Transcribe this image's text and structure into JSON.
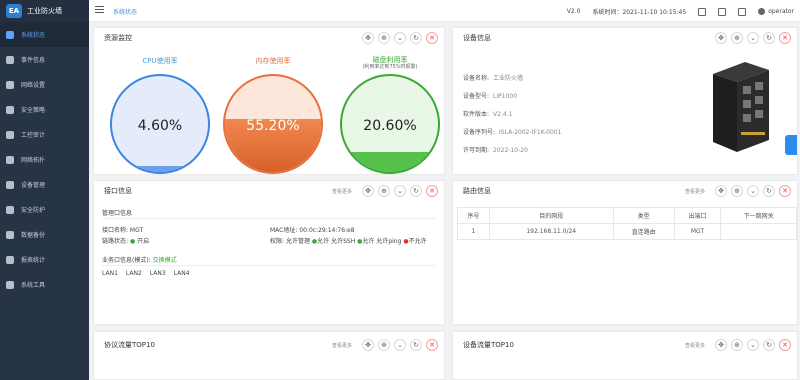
{
  "app": {
    "logo_badge": "EA",
    "title": "工业防火墙"
  },
  "sidebar": {
    "items": [
      {
        "label": "系统状态",
        "icon": "dashboard-icon"
      },
      {
        "label": "事件信息",
        "icon": "event-icon"
      },
      {
        "label": "网络设置",
        "icon": "network-icon"
      },
      {
        "label": "安全策略",
        "icon": "policy-icon"
      },
      {
        "label": "工控审计",
        "icon": "audit-icon"
      },
      {
        "label": "网络拓扑",
        "icon": "topology-icon"
      },
      {
        "label": "设备管理",
        "icon": "device-icon"
      },
      {
        "label": "安全防护",
        "icon": "shield-icon"
      },
      {
        "label": "数据备份",
        "icon": "backup-icon"
      },
      {
        "label": "报表统计",
        "icon": "report-icon"
      },
      {
        "label": "系统工具",
        "icon": "tools-icon"
      }
    ]
  },
  "header": {
    "breadcrumb": "系统状态",
    "version": "V2.0",
    "time_label": "系统时间：2021-11-10 10:15:45",
    "user": "operator"
  },
  "panels": {
    "resource": {
      "title": "资源监控",
      "cpu": {
        "label": "CPU使用率",
        "value": "4.60%",
        "fraction": 0.046
      },
      "mem": {
        "label": "内存使用率",
        "value": "55.20%",
        "fraction": 0.552
      },
      "disk": {
        "label": "磁盘利用率",
        "sub": "(利用率达到75%时报警)",
        "value": "20.60%",
        "fraction": 0.206
      }
    },
    "device": {
      "title": "设备信息",
      "name_label": "设备名称:",
      "name": "工业防火墙",
      "model_label": "设备型号:",
      "model": "LIP1000",
      "sw_label": "软件版本:",
      "sw": "V2.4.1",
      "serial_label": "设备序列号:",
      "serial": "ISLA-2002-IF1K-0001",
      "license_label": "许可到期:",
      "license": "2022-10-20"
    },
    "iface": {
      "title": "接口信息",
      "more": "查看更多",
      "mgmt_title": "管理口信息",
      "name_label": "接口名称: MGT",
      "mac_label": "MAC地址: 00:0c:29:14:76:e8",
      "link_label": "链路状态:",
      "link": "开启",
      "perm_label": "权限:",
      "perm_mgmt": "允许管理",
      "allow1": "允许",
      "perm_ssh": "允许SSH",
      "allow2": "允许",
      "perm_ping": "允许ping",
      "deny": "不允许",
      "biz_label": "业务口信息(模式):",
      "biz_mode": "交换模式",
      "lans": [
        "LAN1",
        "LAN2",
        "LAN3",
        "LAN4"
      ]
    },
    "route": {
      "title": "路由信息",
      "more": "查看更多",
      "headers": [
        "序号",
        "目的网段",
        "类型",
        "出端口",
        "下一跳网关"
      ],
      "rows": [
        [
          "1",
          "192.168.11.0/24",
          "直连路由",
          "MGT",
          ""
        ]
      ]
    },
    "proto": {
      "title": "协议流量TOP10",
      "more": "查看更多"
    },
    "devtraffic": {
      "title": "设备流量TOP10",
      "more": "查看更多"
    }
  }
}
